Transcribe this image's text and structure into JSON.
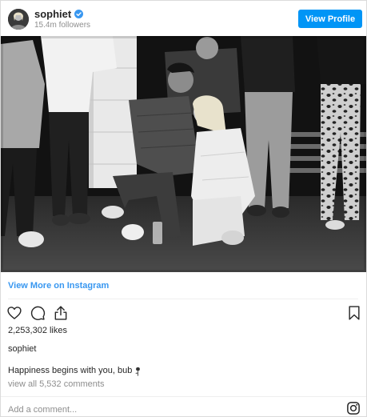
{
  "header": {
    "username": "sophiet",
    "followers": "15.4m followers",
    "view_profile_label": "View Profile",
    "verified_icon": "verified-badge-icon",
    "accent_color": "#0095f6"
  },
  "post": {
    "photo_desc_icon": "photo",
    "view_more_label": "View More on Instagram",
    "likes": "2,253,302 likes",
    "author": "sophiet",
    "caption": "Happiness begins with you, bub",
    "caption_icon": "rose-icon",
    "comments_link": "view all 5,532 comments"
  },
  "actions": {
    "icons": [
      "heart-icon",
      "comment-icon",
      "share-icon",
      "bookmark-icon"
    ]
  },
  "comment_box": {
    "placeholder": "Add a comment...",
    "icon": "instagram-icon"
  },
  "colors": {
    "link": "#3897f0",
    "muted": "#8e8e8e",
    "text": "#262626"
  }
}
